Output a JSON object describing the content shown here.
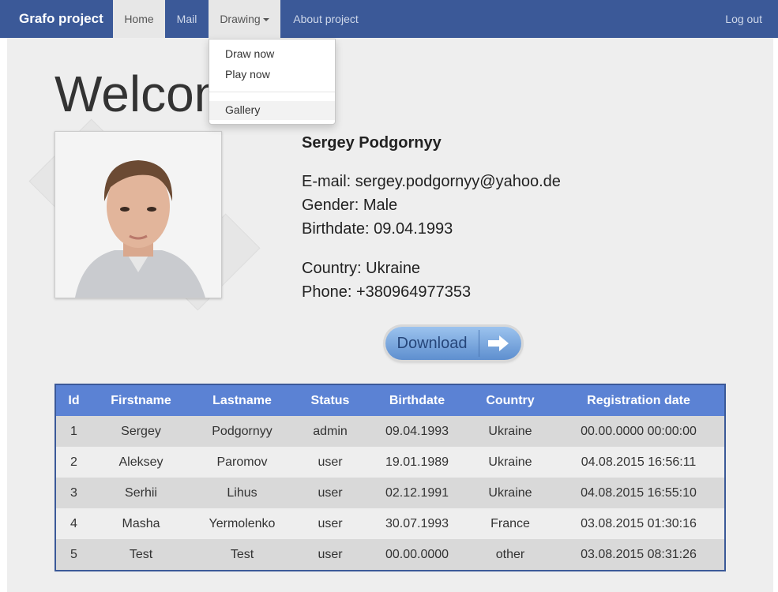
{
  "navbar": {
    "brand": "Grafo project",
    "items": [
      {
        "label": "Home"
      },
      {
        "label": "Mail"
      },
      {
        "label": "Drawing"
      },
      {
        "label": "About project"
      }
    ],
    "logout": "Log out"
  },
  "dropdown": {
    "items": [
      "Draw now",
      "Play now",
      "Gallery"
    ]
  },
  "page": {
    "heading": "Welcome"
  },
  "profile": {
    "name": "Sergey Podgornyy",
    "email": "E-mail: sergey.podgornyy@yahoo.de",
    "gender": "Gender: Male",
    "birthdate": "Birthdate: 09.04.1993",
    "country": "Country: Ukraine",
    "phone": "Phone: +380964977353"
  },
  "download": {
    "label": "Download",
    "icon": "arrow-right-icon"
  },
  "table": {
    "headers": [
      "Id",
      "Firstname",
      "Lastname",
      "Status",
      "Birthdate",
      "Country",
      "Registration date"
    ],
    "rows": [
      [
        "1",
        "Sergey",
        "Podgornyy",
        "admin",
        "09.04.1993",
        "Ukraine",
        "00.00.0000 00:00:00"
      ],
      [
        "2",
        "Aleksey",
        "Paromov",
        "user",
        "19.01.1989",
        "Ukraine",
        "04.08.2015 16:56:11"
      ],
      [
        "3",
        "Serhii",
        "Lihus",
        "user",
        "02.12.1991",
        "Ukraine",
        "04.08.2015 16:55:10"
      ],
      [
        "4",
        "Masha",
        "Yermolenko",
        "user",
        "30.07.1993",
        "France",
        "03.08.2015 01:30:16"
      ],
      [
        "5",
        "Test",
        "Test",
        "user",
        "00.00.0000",
        "other",
        "03.08.2015 08:31:26"
      ]
    ]
  },
  "colors": {
    "navbar": "#3b5998",
    "table_header": "#5b82d4",
    "button": "#6c9ad6"
  }
}
